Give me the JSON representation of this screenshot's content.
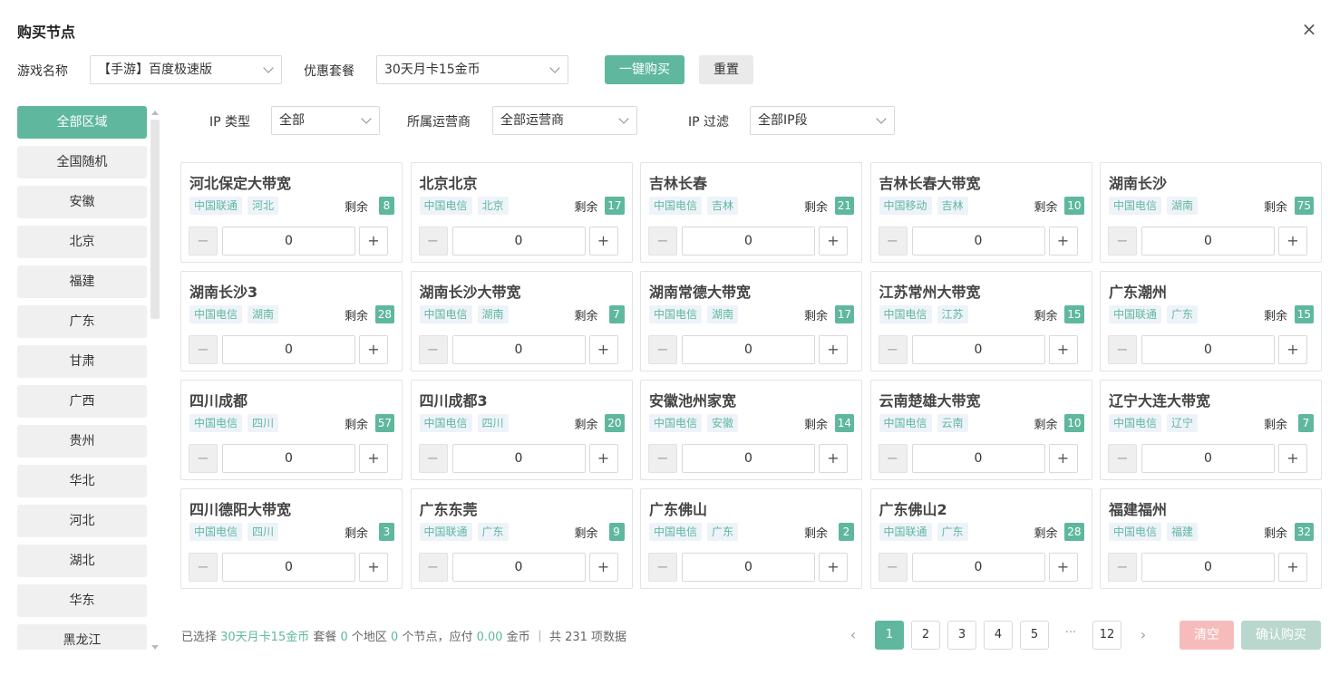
{
  "dialog": {
    "title": "购买节点",
    "close": "×"
  },
  "filters": {
    "game_label": "游戏名称",
    "game_value": "【手游】百度极速版",
    "package_label": "优惠套餐",
    "package_value": "30天月卡15金币",
    "buy_label": "一键购买",
    "reset_label": "重置",
    "ip_type_label": "IP 类型",
    "ip_type_value": "全部",
    "isp_label": "所属运营商",
    "isp_value": "全部运营商",
    "ip_filter_label": "IP 过滤",
    "ip_filter_value": "全部IP段"
  },
  "sidebar": {
    "items": [
      {
        "label": "全部区域",
        "active": true
      },
      {
        "label": "全国随机"
      },
      {
        "label": "安徽"
      },
      {
        "label": "北京"
      },
      {
        "label": "福建"
      },
      {
        "label": "广东"
      },
      {
        "label": "甘肃"
      },
      {
        "label": "广西"
      },
      {
        "label": "贵州"
      },
      {
        "label": "华北"
      },
      {
        "label": "河北"
      },
      {
        "label": "湖北"
      },
      {
        "label": "华东"
      },
      {
        "label": "黑龙江"
      }
    ]
  },
  "remain_label": "剩余",
  "nodes": [
    {
      "name": "河北保定大带宽",
      "isp": "中国联通",
      "region": "河北",
      "remain": "8",
      "qty": "0"
    },
    {
      "name": "北京北京",
      "isp": "中国电信",
      "region": "北京",
      "remain": "17",
      "qty": "0"
    },
    {
      "name": "吉林长春",
      "isp": "中国电信",
      "region": "吉林",
      "remain": "21",
      "qty": "0"
    },
    {
      "name": "吉林长春大带宽",
      "isp": "中国移动",
      "region": "吉林",
      "remain": "10",
      "qty": "0"
    },
    {
      "name": "湖南长沙",
      "isp": "中国电信",
      "region": "湖南",
      "remain": "75",
      "qty": "0"
    },
    {
      "name": "湖南长沙3",
      "isp": "中国电信",
      "region": "湖南",
      "remain": "28",
      "qty": "0"
    },
    {
      "name": "湖南长沙大带宽",
      "isp": "中国电信",
      "region": "湖南",
      "remain": "7",
      "qty": "0"
    },
    {
      "name": "湖南常德大带宽",
      "isp": "中国电信",
      "region": "湖南",
      "remain": "17",
      "qty": "0"
    },
    {
      "name": "江苏常州大带宽",
      "isp": "中国电信",
      "region": "江苏",
      "remain": "15",
      "qty": "0"
    },
    {
      "name": "广东潮州",
      "isp": "中国联通",
      "region": "广东",
      "remain": "15",
      "qty": "0"
    },
    {
      "name": "四川成都",
      "isp": "中国电信",
      "region": "四川",
      "remain": "57",
      "qty": "0"
    },
    {
      "name": "四川成都3",
      "isp": "中国电信",
      "region": "四川",
      "remain": "20",
      "qty": "0"
    },
    {
      "name": "安徽池州家宽",
      "isp": "中国电信",
      "region": "安徽",
      "remain": "14",
      "qty": "0"
    },
    {
      "name": "云南楚雄大带宽",
      "isp": "中国电信",
      "region": "云南",
      "remain": "10",
      "qty": "0"
    },
    {
      "name": "辽宁大连大带宽",
      "isp": "中国电信",
      "region": "辽宁",
      "remain": "7",
      "qty": "0"
    },
    {
      "name": "四川德阳大带宽",
      "isp": "中国电信",
      "region": "四川",
      "remain": "3",
      "qty": "0"
    },
    {
      "name": "广东东莞",
      "isp": "中国联通",
      "region": "广东",
      "remain": "9",
      "qty": "0"
    },
    {
      "name": "广东佛山",
      "isp": "中国电信",
      "region": "广东",
      "remain": "2",
      "qty": "0"
    },
    {
      "name": "广东佛山2",
      "isp": "中国联通",
      "region": "广东",
      "remain": "28",
      "qty": "0"
    },
    {
      "name": "福建福州",
      "isp": "中国电信",
      "region": "福建",
      "remain": "32",
      "qty": "0"
    }
  ],
  "summary": {
    "p1": "已选择 ",
    "package": "30天月卡15金币",
    "p2": " 套餐 ",
    "regions": "0",
    "p3": " 个地区 ",
    "nodes": "0",
    "p4": " 个节点，应付 ",
    "cost": "0.00",
    "p5": " 金币 ｜ 共 231 项数据"
  },
  "pagination": {
    "prev": "‹",
    "next": "›",
    "pages": [
      "1",
      "2",
      "3",
      "4",
      "5"
    ],
    "ellipsis": "···",
    "last": "12",
    "current": "1"
  },
  "actions": {
    "clear": "清空",
    "confirm": "确认购买"
  },
  "colors": {
    "accent": "#5fb89e",
    "danger_light": "#f6bcbc",
    "confirm_disabled": "#b9d7cd"
  }
}
